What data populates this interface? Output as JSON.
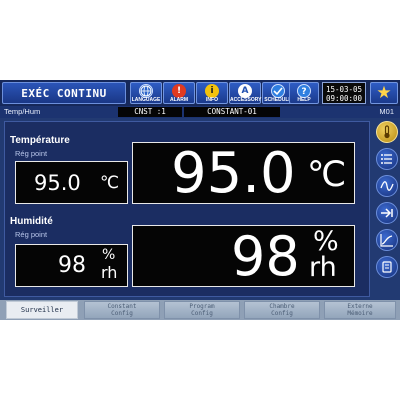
{
  "topbar": {
    "mode": "EXÉC CONTINU",
    "buttons": [
      {
        "label": "LANGUAGE",
        "icon": "globe-icon",
        "color": "#2a63c9"
      },
      {
        "label": "ALARM",
        "icon": "alarm-icon",
        "color": "#e03a20"
      },
      {
        "label": "INFO",
        "icon": "info-icon",
        "color": "#f2c20c"
      },
      {
        "label": "ACCESSORY",
        "icon": "accessory-icon",
        "color": "#2f7fe0"
      },
      {
        "label": "SCHEDULE",
        "icon": "schedule-icon",
        "color": "#2f7fe0"
      },
      {
        "label": "HELP",
        "icon": "help-icon",
        "color": "#2f7fe0"
      }
    ],
    "date": "15-03-05",
    "time": "09:00:00",
    "favorite_icon": "star-icon"
  },
  "subbar": {
    "left": "Temp/Hum",
    "cnst": "CNST :1",
    "program": "CONSTANT-01",
    "mode_code": "M01"
  },
  "temperature": {
    "title": "Température",
    "setpoint_label": "Rég point",
    "setpoint_value": "95.0",
    "setpoint_unit": "℃",
    "current_value": "95.0",
    "current_unit": "℃"
  },
  "humidity": {
    "title": "Humidité",
    "setpoint_label": "Rég point",
    "setpoint_value": "98",
    "setpoint_unit_top": "%",
    "setpoint_unit_bottom": "rh",
    "current_value": "98",
    "current_unit_top": "%",
    "current_unit_bottom": "rh"
  },
  "side_buttons": [
    "thermometer-icon",
    "list-icon",
    "wave-icon",
    "forward-icon",
    "graph-icon",
    "settings-icon"
  ],
  "tabs": [
    {
      "line1": "Surveiller",
      "line2": ""
    },
    {
      "line1": "Constant",
      "line2": "Config"
    },
    {
      "line1": "Program",
      "line2": "Config"
    },
    {
      "line1": "Chambre",
      "line2": "Config"
    },
    {
      "line1": "Externe",
      "line2": "Mémoire"
    }
  ]
}
